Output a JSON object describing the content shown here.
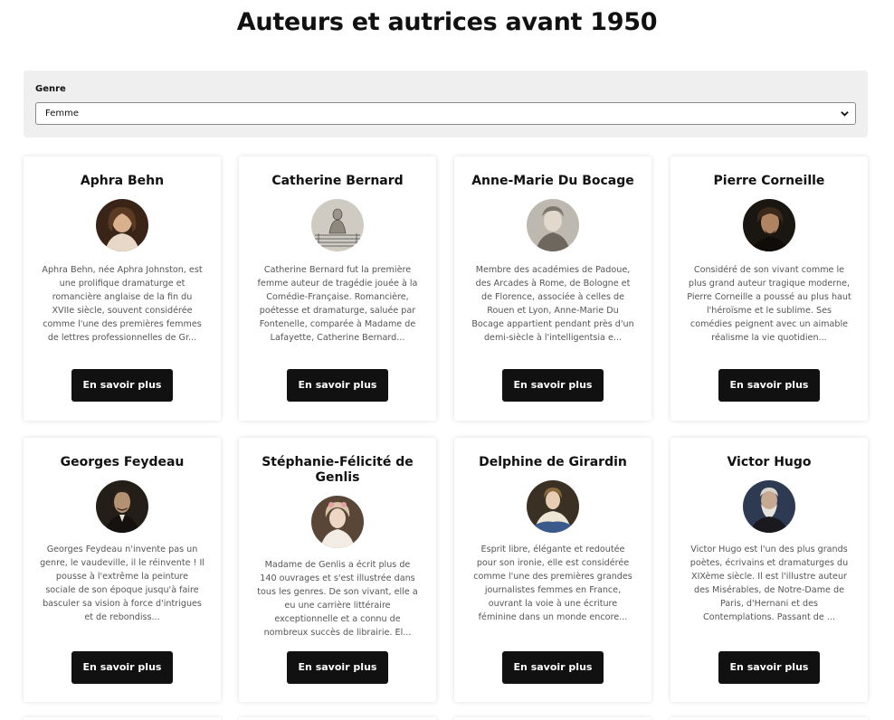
{
  "page": {
    "title": "Auteurs et autrices avant 1950"
  },
  "filter": {
    "label": "Genre",
    "selected": "Femme",
    "icon": "chevron-down-icon"
  },
  "authors": [
    {
      "name": "Aphra Behn",
      "description": "Aphra Behn, née Aphra Johnston, est une prolifique dramaturge et romancière anglaise de la fin du XVIIe siècle, souvent considérée comme l'une des premières femmes de lettres professionnelles de Gr...",
      "button": "En savoir plus"
    },
    {
      "name": "Catherine Bernard",
      "description": "Catherine Bernard fut la première femme auteur de tragédie jouée à la Comédie-Française. Romancière, poétesse et dramaturge, saluée par Fontenelle, comparée à Madame de Lafayette, Catherine Bernard...",
      "button": "En savoir plus"
    },
    {
      "name": "Anne-Marie Du Bocage",
      "description": "Membre des académies de Padoue, des Arcades à Rome, de Bologne et de Florence, associée à celles de Rouen et Lyon, Anne-Marie Du Bocage appartient pendant près d'un demi-siècle à l'intelligentsia e...",
      "button": "En savoir plus"
    },
    {
      "name": "Pierre Corneille",
      "description": "Considéré de son vivant comme le plus grand auteur tragique moderne, Pierre Corneille a poussé au plus haut l'héroïsme et le sublime. Ses comédies peignent avec un aimable réalisme la vie quotidien...",
      "button": "En savoir plus"
    },
    {
      "name": "Georges Feydeau",
      "description": "Georges Feydeau n'invente pas un genre, le vaudeville, il le réinvente ! Il pousse à l'extrême la peinture sociale de son époque jusqu'à faire basculer sa vision à force d'intrigues et de rebondiss...",
      "button": "En savoir plus"
    },
    {
      "name": "Stéphanie-Félicité de Genlis",
      "description": "Madame de Genlis a écrit plus de 140 ouvrages et s'est illustrée dans tous les genres. De son vivant, elle a eu une carrière littéraire exceptionnelle et a connu de nombreux succès de librairie. El...",
      "button": "En savoir plus"
    },
    {
      "name": "Delphine de Girardin",
      "description": "Esprit libre, élégante et redoutée pour son ironie, elle est considérée comme l'une des premières grandes journalistes femmes en France, ouvrant la voie à une écriture féminine dans un monde encore...",
      "button": "En savoir plus"
    },
    {
      "name": "Victor Hugo",
      "description": "Victor Hugo est l'un des plus grands poètes, écrivains et dramaturges du XIXème siècle. Il est l'illustre auteur des Misérables, de Notre-Dame de Paris, d'Hernani et des Contemplations. Passant de ...",
      "button": "En savoir plus"
    }
  ]
}
